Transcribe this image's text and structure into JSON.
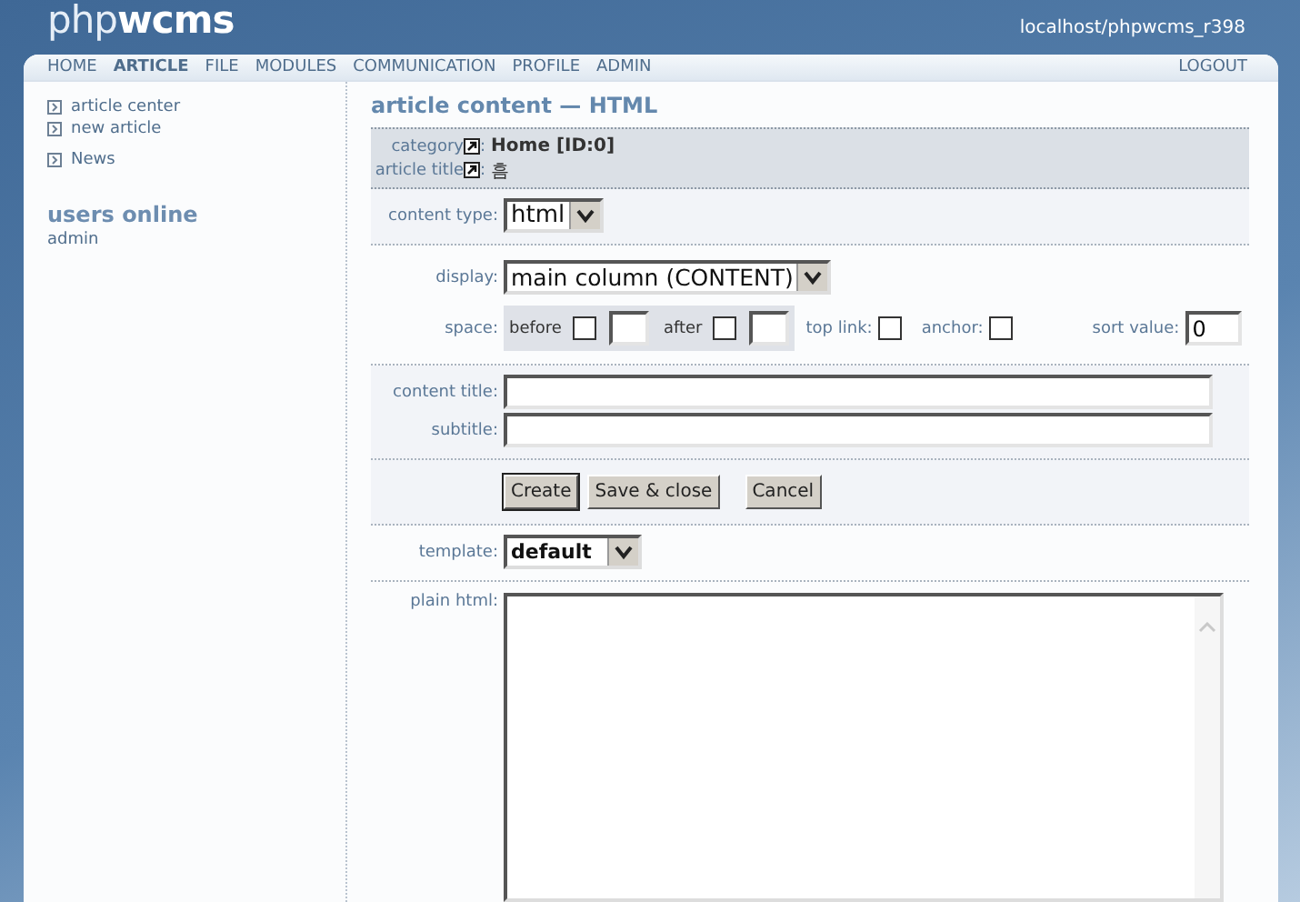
{
  "header": {
    "logo": {
      "light": "php",
      "bold": "wcms"
    },
    "host": "localhost/phpwcms_r398"
  },
  "nav": {
    "items": [
      {
        "label": "HOME",
        "selected": false
      },
      {
        "label": "ARTICLE",
        "selected": true
      },
      {
        "label": "FILE",
        "selected": false
      },
      {
        "label": "MODULES",
        "selected": false
      },
      {
        "label": "COMMUNICATION",
        "selected": false
      },
      {
        "label": "PROFILE",
        "selected": false
      },
      {
        "label": "ADMIN",
        "selected": false
      }
    ],
    "logout": "LOGOUT"
  },
  "sidebar": {
    "link_groups": [
      [
        "article center",
        "new article"
      ],
      [
        "News"
      ]
    ],
    "users_online": {
      "title": "users online",
      "users": [
        "admin"
      ]
    }
  },
  "content": {
    "title": "article content — HTML",
    "info": [
      {
        "label": "category",
        "colon": ":",
        "value": "Home [ID:0]",
        "bold": true
      },
      {
        "label": "article title",
        "colon": ":",
        "value": "흠",
        "bold": false
      }
    ],
    "content_type": {
      "label": "content type:",
      "value": "html"
    },
    "display": {
      "label": "display:",
      "value": "main column (CONTENT)"
    },
    "space": {
      "label": "space:",
      "before": {
        "label": "before",
        "checked": false
      },
      "after": {
        "label": "after",
        "checked": false
      },
      "top_link": {
        "label": "top link:",
        "checked": false
      },
      "anchor": {
        "label": "anchor:",
        "checked": false
      },
      "sort_value": {
        "label": "sort value:",
        "value": "0"
      }
    },
    "titles": [
      {
        "label": "content title:"
      },
      {
        "label": "subtitle:"
      }
    ],
    "buttons": [
      {
        "label": "Create",
        "kind": "primary"
      },
      {
        "label": "Save & close",
        "kind": "normal"
      },
      {
        "label": "Cancel",
        "kind": "cancel"
      }
    ],
    "template": {
      "label": "template:",
      "value": "default"
    },
    "plain_html": {
      "label": "plain html:"
    }
  }
}
